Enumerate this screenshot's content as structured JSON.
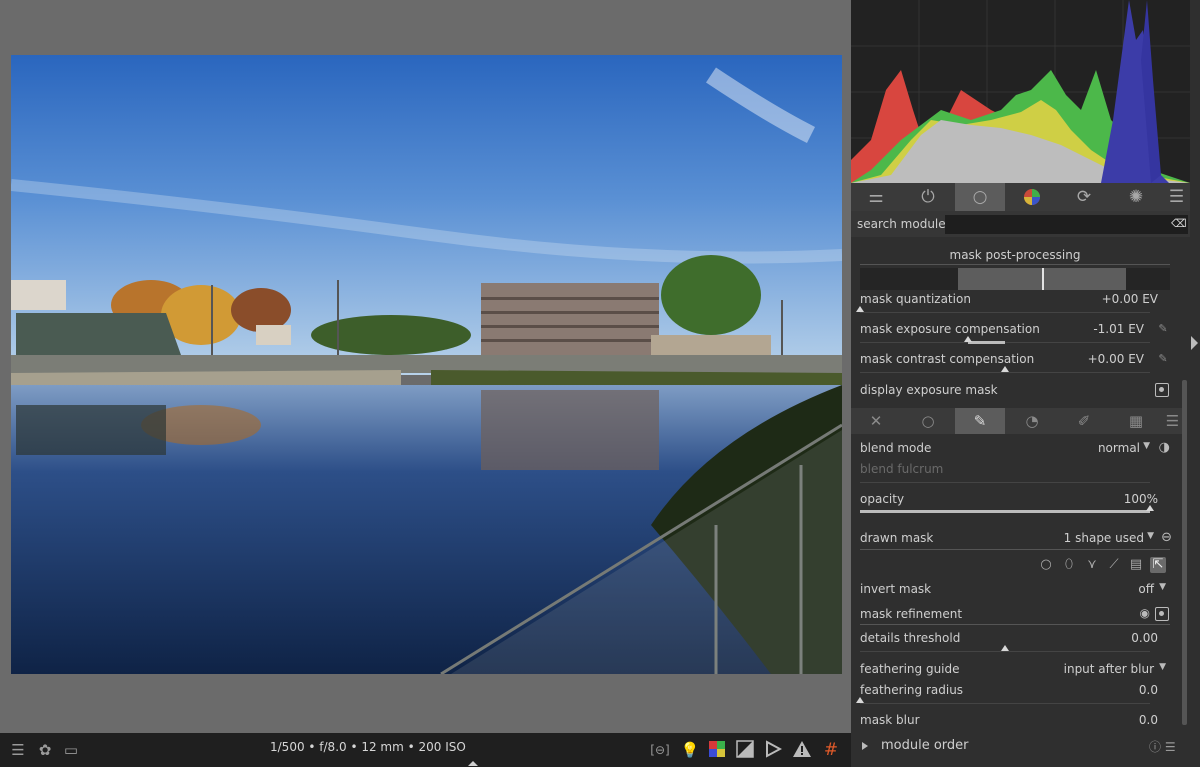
{
  "photo": {
    "exif": "1/500 • f/8.0 • 12 mm • 200 ISO"
  },
  "bottombar": {
    "left_icons": [
      "menu-icon",
      "styles-icon",
      "display-icon"
    ],
    "right_icons": [
      "focus-peaking-icon",
      "lightbulb-icon",
      "color-assessment-icon",
      "softproof-icon",
      "gamut-check-icon",
      "warning-icon",
      "guides-icon"
    ]
  },
  "group_tabs": [
    "presets-icon",
    "power-icon",
    "base-icon",
    "color-icon",
    "correct-icon",
    "effect-icon",
    "menu-icon"
  ],
  "search": {
    "label": "search module",
    "placeholder": ""
  },
  "mask_post_processing": {
    "title": "mask post-processing",
    "rows": [
      {
        "label": "mask quantization",
        "value": "+0.00 EV"
      },
      {
        "label": "mask exposure compensation",
        "value": "-1.01 EV"
      },
      {
        "label": "mask contrast compensation",
        "value": "+0.00 EV"
      },
      {
        "label": "display exposure mask",
        "value": ""
      }
    ]
  },
  "mask_tabs": [
    "off-icon",
    "uniform-icon",
    "drawn-mask-icon",
    "parametric-icon",
    "drawn-parametric-icon",
    "raster-icon",
    "menu-icon"
  ],
  "blend": {
    "blend_mode_label": "blend mode",
    "blend_mode_value": "normal",
    "blend_fulcrum_label": "blend fulcrum",
    "opacity_label": "opacity",
    "opacity_value": "100%",
    "drawn_mask_label": "drawn mask",
    "drawn_mask_value": "1 shape used",
    "invert_mask_label": "invert mask",
    "invert_mask_value": "off",
    "mask_refinement_label": "mask refinement",
    "details_threshold_label": "details threshold",
    "details_threshold_value": "0.00",
    "feathering_guide_label": "feathering guide",
    "feathering_guide_value": "input after blur",
    "feathering_radius_label": "feathering radius",
    "feathering_radius_value": "0.0",
    "mask_blur_label": "mask blur",
    "mask_blur_value": "0.0"
  },
  "module_order": {
    "label": "module order"
  },
  "histogram": {
    "colors": {
      "red": "#d8463f",
      "green": "#4cb84a",
      "blue": "#3c3ca8",
      "yellow": "#cfcf45",
      "gray": "#bdbdbd"
    }
  }
}
